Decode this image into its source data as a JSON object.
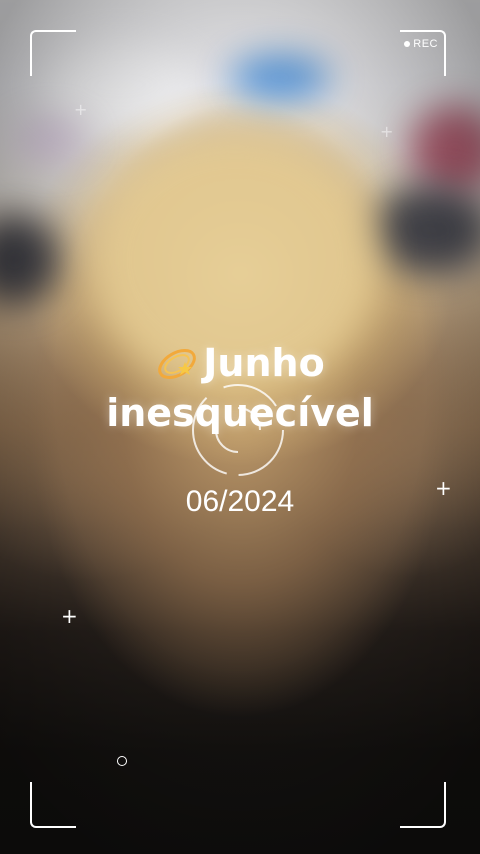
{
  "overlay": {
    "rec_label": "REC",
    "title_line1": "Junho",
    "title_line2": "inesquecível",
    "title_emoji": "dizzy-comet-icon",
    "date": "06/2024"
  },
  "colors": {
    "frame": "#ffffff",
    "text": "#ffffff"
  }
}
